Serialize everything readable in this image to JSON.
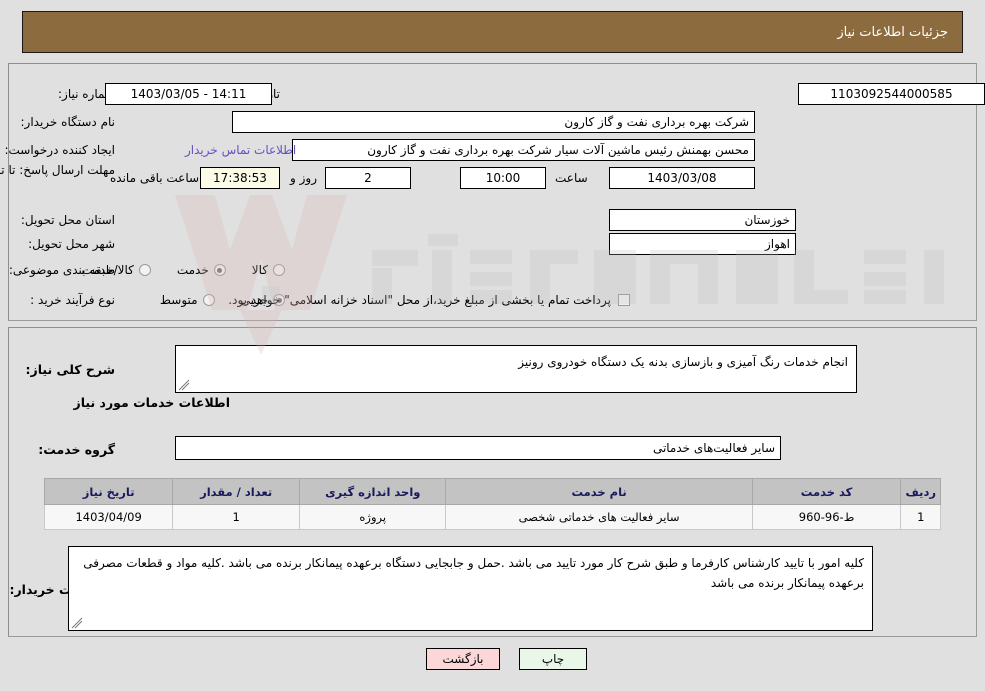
{
  "header": {
    "title": "جزئیات اطلاعات نیاز"
  },
  "form": {
    "need_number_label": "شماره نیاز:",
    "need_number_value": "1103092544000585",
    "announce_datetime_label": "تاریخ و ساعت اعلان عمومی:",
    "announce_datetime_value": "1403/03/05 - 14:11",
    "buyer_org_label": "نام دستگاه خریدار:",
    "buyer_org_value": "شرکت بهره برداری نفت و گاز کارون",
    "requester_label": "ایجاد کننده درخواست:",
    "requester_value": "محسن بهمنش رئیس ماشین آلات سیار شرکت بهره برداری نفت و گاز کارون",
    "contact_link": "اطلاعات تماس خریدار",
    "deadline_label": "مهلت ارسال پاسخ: تا تاریخ:",
    "deadline_date": "1403/03/08",
    "deadline_hour_label": "ساعت",
    "deadline_hour_value": "10:00",
    "remaining_days": "2",
    "remaining_days_label": "روز و",
    "remaining_time": "17:38:53",
    "remaining_time_label": "ساعت باقی مانده",
    "province_label": "استان محل تحویل:",
    "province_value": "خوزستان",
    "city_label": "شهر محل تحویل:",
    "city_value": "اهواز",
    "category_label": "طبقه بندی موضوعی:",
    "category_options": [
      {
        "label": "کالا",
        "checked": false
      },
      {
        "label": "خدمت",
        "checked": true
      },
      {
        "label": "کالا/خدمت",
        "checked": false
      }
    ],
    "process_label": "نوع فرآیند خرید :",
    "process_options": [
      {
        "label": "جزیی",
        "checked": true
      },
      {
        "label": "متوسط",
        "checked": false
      }
    ],
    "treasury_checkbox_label": "پرداخت تمام یا بخشی از مبلغ خرید،از محل \"اسناد خزانه اسلامی\" خواهد بود.",
    "treasury_checked": false
  },
  "details": {
    "general_desc_label": "شرح کلی نیاز:",
    "general_desc_value": "انجام خدمات رنگ آمیزی و بازسازی بدنه یک دستگاه خودروی رونیز",
    "services_section_title": "اطلاعات خدمات مورد نیاز",
    "service_group_label": "گروه خدمت:",
    "service_group_value": "سایر فعالیت‌های خدماتی",
    "buyer_notes_label": "توضیحات خریدار:",
    "buyer_notes_value": "کلیه امور با تایید کارشناس کارفرما و طبق شرح کار مورد تایید می باشد .حمل و جابجایی دستگاه برعهده پیمانکار برنده می باشد .کلیه مواد و قطعات مصرفی برعهده پیمانکار برنده می باشد"
  },
  "table": {
    "columns": [
      "ردیف",
      "کد خدمت",
      "نام خدمت",
      "واحد اندازه گیری",
      "تعداد / مقدار",
      "تاریخ نیاز"
    ],
    "rows": [
      {
        "index": "1",
        "code": "ط-96-960",
        "name": "سایر فعالیت های خدماتی شخصی",
        "unit": "پروژه",
        "quantity": "1",
        "need_date": "1403/04/09"
      }
    ]
  },
  "footer": {
    "print_label": "چاپ",
    "back_label": "بازگشت"
  },
  "watermark": {
    "text": "AriaTender.net"
  },
  "colors": {
    "header_brown": "#8c6c3e",
    "page_background": "#e0e0e0",
    "link_purple": "#6a4fc4",
    "table_header_gray": "#c3c3c3",
    "table_header_text": "#19195e",
    "highlight_yellow": "#fbfbe8",
    "print_button_green": "#e9f7e9",
    "back_button_pink": "#fbd7d7"
  }
}
